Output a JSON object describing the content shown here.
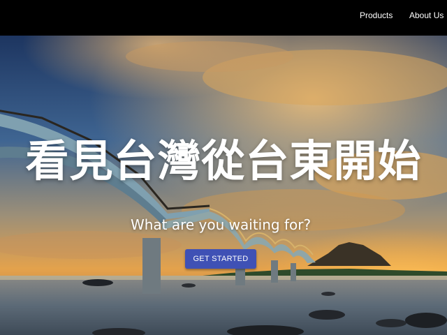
{
  "nav": {
    "items": [
      {
        "label": "Products"
      },
      {
        "label": "About Us"
      }
    ]
  },
  "hero": {
    "title": "看見台灣從台東開始",
    "subtitle": "What are you waiting for?",
    "cta_label": "GET STARTED",
    "image_subject": "arched-bridge-over-sea-at-sunset"
  },
  "colors": {
    "navbar_bg": "#000000",
    "cta_bg": "#3f51b5",
    "text": "#ffffff",
    "sky_top": "#233e6e",
    "sunset": "#f2b34a"
  }
}
